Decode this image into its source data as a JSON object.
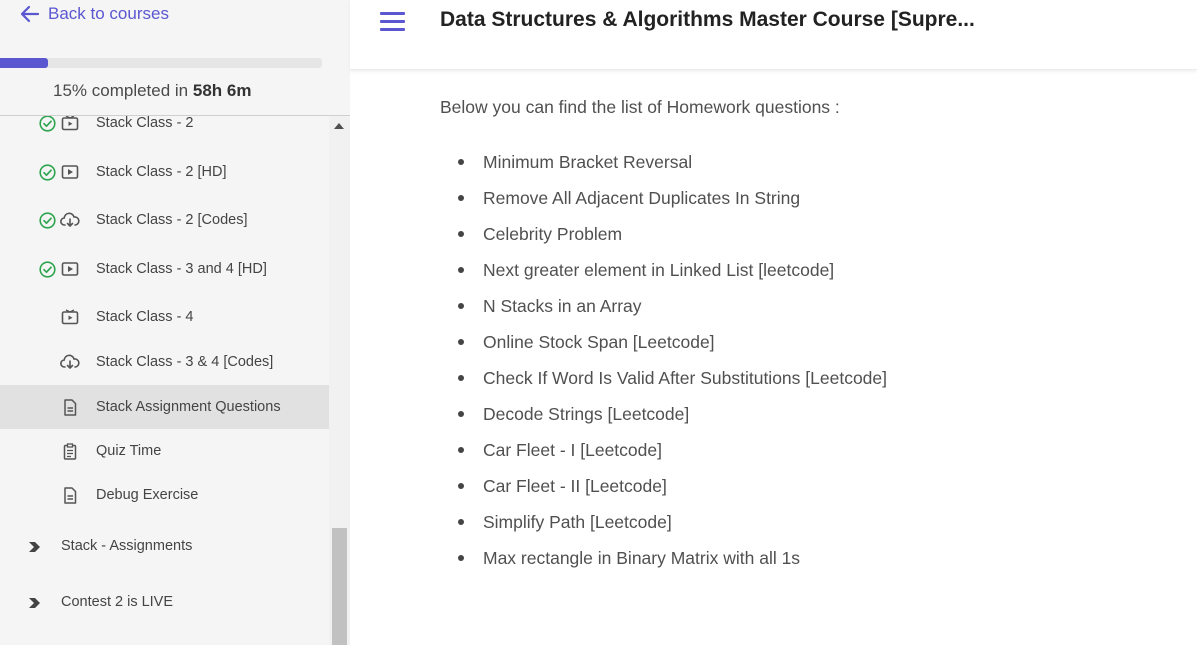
{
  "sidebar": {
    "back_label": "Back to courses",
    "progress": {
      "percent": 15,
      "prefix": "15% completed in ",
      "time": "58h 6m"
    },
    "lessons": [
      {
        "label": "Stack Class - 2",
        "type": "video-icon",
        "completed": true
      },
      {
        "label": "Stack Class - 2 [HD]",
        "type": "play-icon",
        "completed": true
      },
      {
        "label": "Stack Class - 2 [Codes]",
        "type": "cloud-download-icon",
        "completed": true
      },
      {
        "label": "Stack Class - 3 and 4 [HD]",
        "type": "play-icon",
        "completed": true
      },
      {
        "label": "Stack Class - 4",
        "type": "video-icon",
        "completed": false
      },
      {
        "label": "Stack Class - 3 & 4 [Codes]",
        "type": "cloud-download-icon",
        "completed": false
      },
      {
        "label": "Stack Assignment Questions",
        "type": "document-icon",
        "completed": false,
        "active": true
      },
      {
        "label": "Quiz Time",
        "type": "quiz-icon",
        "completed": false
      },
      {
        "label": "Debug Exercise",
        "type": "document-icon",
        "completed": false
      }
    ],
    "sections": [
      {
        "label": "Stack - Assignments"
      },
      {
        "label": "Contest 2 is LIVE"
      }
    ]
  },
  "header": {
    "title": "Data Structures & Algorithms Master Course [Supre..."
  },
  "main": {
    "intro": "Below you can find the list of Homework questions :",
    "questions": [
      "Minimum Bracket Reversal",
      "Remove All Adjacent Duplicates In String",
      "Celebrity Problem",
      "Next greater element in Linked List [leetcode]",
      "N Stacks in an Array",
      "Online Stock Span [Leetcode]",
      "Check If Word Is Valid After Substitutions [Leetcode]",
      "Decode Strings [Leetcode]",
      "Car Fleet - I [Leetcode]",
      "Car Fleet - II [Leetcode]",
      "Simplify Path [Leetcode]",
      "Max rectangle in Binary Matrix with all 1s"
    ]
  },
  "colors": {
    "accent": "#5b57d1",
    "check": "#2ea44f",
    "sidebar_bg": "#f5f5f5",
    "active_bg": "#e1e1e1"
  }
}
